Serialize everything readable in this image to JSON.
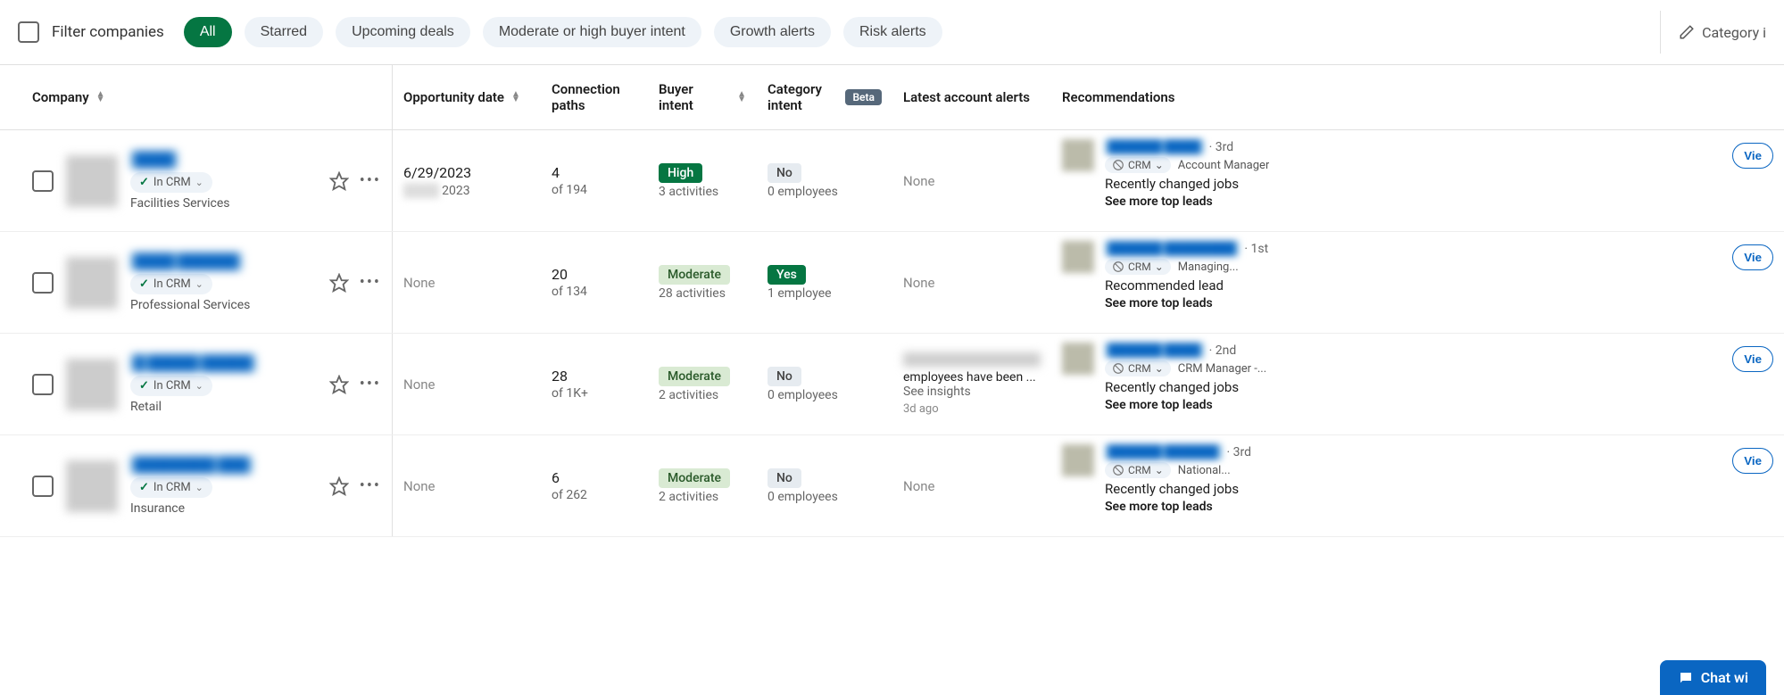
{
  "filter": {
    "label": "Filter companies",
    "pills": [
      "All",
      "Starred",
      "Upcoming deals",
      "Moderate or high buyer intent",
      "Growth alerts",
      "Risk alerts"
    ],
    "active_index": 0,
    "right_action": "Category i"
  },
  "columns": {
    "company": "Company",
    "opportunity": "Opportunity date",
    "connection": "Connection paths",
    "buyer": "Buyer intent",
    "category": "Category intent",
    "category_badge": "Beta",
    "alerts": "Latest account alerts",
    "recommendations": "Recommendations"
  },
  "crm_chip": {
    "label": "In CRM",
    "label_sm": "CRM"
  },
  "rows": [
    {
      "company_name": "████",
      "industry": "Facilities Services",
      "opp_main": "6/29/2023",
      "opp_sub_blur": "████",
      "opp_sub_year": "2023",
      "conn_main": "4",
      "conn_sub": "of 194",
      "buyer_level": "High",
      "buyer_class": "badge-high",
      "buyer_sub": "3 activities",
      "cat_level": "No",
      "cat_class": "badge-no",
      "cat_sub": "0 employees",
      "alerts_none": "None",
      "rec": {
        "name": "██████ ████",
        "degree": "· 3rd",
        "title": "Account Manager",
        "reason": "Recently changed jobs",
        "see_more": "See more top leads",
        "view": "Vie"
      }
    },
    {
      "company_name": "████ ██████",
      "industry": "Professional Services",
      "opp_none": "None",
      "conn_main": "20",
      "conn_sub": "of 134",
      "buyer_level": "Moderate",
      "buyer_class": "badge-moderate",
      "buyer_sub": "28 activities",
      "cat_level": "Yes",
      "cat_class": "badge-yes",
      "cat_sub": "1 employee",
      "alerts_none": "None",
      "rec": {
        "name": "██████ ████████",
        "degree": "· 1st",
        "title": "Managing...",
        "reason": "Recommended lead",
        "see_more": "See more top leads",
        "view": "Vie"
      }
    },
    {
      "company_name": "█ █████ █████",
      "industry": "Retail",
      "opp_none": "None",
      "conn_main": "28",
      "conn_sub": "of 1K+",
      "buyer_level": "Moderate",
      "buyer_class": "badge-moderate",
      "buyer_sub": "2 activities",
      "cat_level": "No",
      "cat_class": "badge-no",
      "cat_sub": "0 employees",
      "alerts_text": "employees have been ...",
      "alerts_see": "See insights",
      "alerts_time": "3d ago",
      "rec": {
        "name": "██████ ████",
        "degree": "· 2nd",
        "title": "CRM Manager -...",
        "reason": "Recently changed jobs",
        "see_more": "See more top leads",
        "view": "Vie"
      }
    },
    {
      "company_name": "████████ ███",
      "industry": "Insurance",
      "opp_none": "None",
      "conn_main": "6",
      "conn_sub": "of 262",
      "buyer_level": "Moderate",
      "buyer_class": "badge-moderate",
      "buyer_sub": "2 activities",
      "cat_level": "No",
      "cat_class": "badge-no",
      "cat_sub": "0 employees",
      "alerts_none": "None",
      "rec": {
        "name": "██████ ██████",
        "degree": "· 3rd",
        "title": "National...",
        "reason": "Recently changed jobs",
        "see_more": "See more top leads",
        "view": "Vie"
      }
    }
  ],
  "chat": "Chat wi"
}
